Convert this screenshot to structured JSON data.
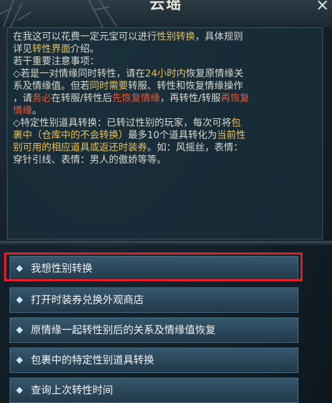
{
  "window": {
    "title": "云瑶",
    "close_label": "×"
  },
  "description": {
    "segments": [
      {
        "text": "在我这可以花费一定元宝可以进行",
        "style": "n"
      },
      {
        "text": "性别转换",
        "style": "y"
      },
      {
        "text": "，具体规则\n详见",
        "style": "n"
      },
      {
        "text": "转性界面",
        "style": "y"
      },
      {
        "text": "介绍。\n若干重要注意事项：\n◇若是一对情缘同时转性，请在",
        "style": "n"
      },
      {
        "text": "24小时内",
        "style": "y"
      },
      {
        "text": "恢复原情缘关\n系及情缘值。但若",
        "style": "n"
      },
      {
        "text": "同时需要",
        "style": "y"
      },
      {
        "text": "转服、转性和恢复情缘操作\n，请",
        "style": "n"
      },
      {
        "text": "务必",
        "style": "r"
      },
      {
        "text": "在转服/转性后",
        "style": "n"
      },
      {
        "text": "先恢复情缘",
        "style": "r"
      },
      {
        "text": "，再转性/转服",
        "style": "n"
      },
      {
        "text": "再恢复\n情缘",
        "style": "r"
      },
      {
        "text": "。\n◇特定性别道具转换：已转过性别的玩家，每次可将",
        "style": "n"
      },
      {
        "text": "包\n裹中（仓库中的不会转换）",
        "style": "y"
      },
      {
        "text": "最多10个道具转化为",
        "style": "n"
      },
      {
        "text": "当前性\n别可用的相应道具或返还时装券",
        "style": "y"
      },
      {
        "text": "。如：风摇丝，表情：\n穿针引线、表情：男人的傲娇等等。",
        "style": "n"
      }
    ]
  },
  "options": [
    {
      "label": "我想性别转换",
      "selected": true
    },
    {
      "label": "打开时装券兑换外观商店",
      "selected": false
    },
    {
      "label": "原情缘一起转性别后的关系及情缘值恢复",
      "selected": false
    },
    {
      "label": "包裹中的特定性别道具转换",
      "selected": false
    },
    {
      "label": "查询上次转性时间",
      "selected": false
    }
  ],
  "colors": {
    "highlight_border": "#e51f2a",
    "yellow_text": "#e8c05a",
    "red_text": "#e15a3a"
  }
}
